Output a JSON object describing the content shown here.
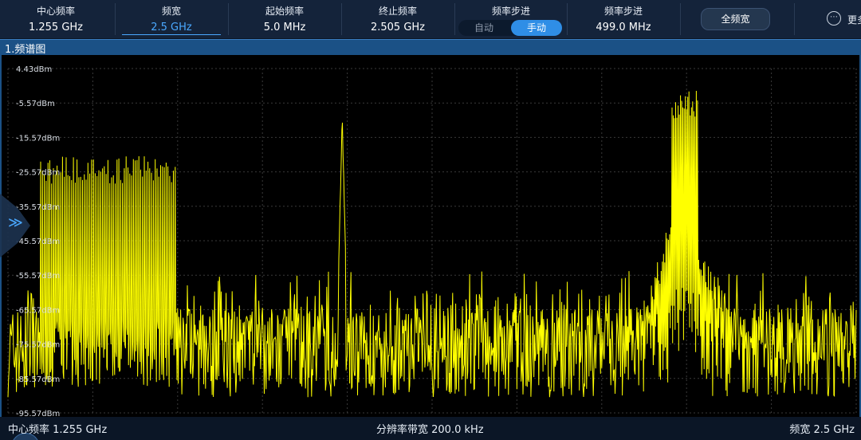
{
  "toolbar": {
    "params": [
      {
        "label": "中心频率",
        "value": "1.255 GHz"
      },
      {
        "label": "频宽",
        "value": "2.5 GHz"
      },
      {
        "label": "起始频率",
        "value": "5.0 MHz"
      },
      {
        "label": "终止频率",
        "value": "2.505 GHz"
      },
      {
        "label": "频率步进",
        "value": ""
      },
      {
        "label": "频率步进",
        "value": "499.0 MHz"
      }
    ],
    "step_mode": {
      "auto": "自动",
      "manual": "手动",
      "selected": "手动"
    },
    "full_span_label": "全频宽",
    "more_label": "更多",
    "more_icon": "ellipsis-icon"
  },
  "panel": {
    "title": "1.频谱图"
  },
  "footer": {
    "center_freq": "中心频率 1.255 GHz",
    "rbw": "分辨率带宽 200.0 kHz",
    "span": "频宽 2.5 GHz"
  },
  "colors": {
    "trace": "#ffff00",
    "grid": "#3a3a3a",
    "background": "#000000",
    "accent": "#2f8ee6"
  },
  "chart_data": {
    "type": "line",
    "title": "",
    "xlabel": "",
    "ylabel": "",
    "x_unit": "GHz",
    "xlim": [
      0.005,
      2.505
    ],
    "ylim": [
      -95.57,
      4.43
    ],
    "y_unit": "dBm",
    "y_ticks": [
      "4.43dBm",
      "-5.57dBm",
      "-15.57dBm",
      "-25.57dBm",
      "-35.57dBm",
      "-45.57dBm",
      "-55.57dBm",
      "-65.57dBm",
      "-75.57dBm",
      "-85.57dBm",
      "-95.57dBm"
    ],
    "grid": true,
    "series": [
      {
        "noise_floor_dBm": -78,
        "peaks": [
          {
            "x_ghz_start": 0.1,
            "x_ghz_end": 0.5,
            "peak_dBm": -21,
            "kind": "comb"
          },
          {
            "x_ghz_start": 0.98,
            "x_ghz_end": 1.0,
            "peak_dBm": -8,
            "kind": "spike"
          },
          {
            "x_ghz_start": 1.96,
            "x_ghz_end": 2.04,
            "peak_dBm": -2,
            "kind": "cluster"
          }
        ]
      }
    ]
  }
}
